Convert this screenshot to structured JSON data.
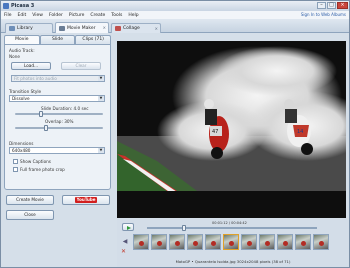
{
  "window": {
    "title": "Picasa 3",
    "minimize": "–",
    "maximize": "□",
    "close": "×"
  },
  "menu": {
    "items": [
      "File",
      "Edit",
      "View",
      "Folder",
      "Picture",
      "Create",
      "Tools",
      "Help"
    ],
    "signin": "Sign In to Web Albums"
  },
  "apptabs": [
    {
      "label": "Library",
      "icon": "library-icon"
    },
    {
      "label": "Movie Maker",
      "icon": "film-icon"
    },
    {
      "label": "Collage",
      "icon": "collage-icon"
    }
  ],
  "subtabs": [
    "Movie",
    "Slide",
    "Clips (71)"
  ],
  "movie": {
    "audio_track_label": "Audio Track:",
    "none_label": "None",
    "load_button": "Load...",
    "clear_button": "Clear",
    "audio_option": "Fit photos into audio",
    "transition_style_label": "Transition Style",
    "transition_style_value": "Dissolve",
    "slide_duration_label": "Slide Duration: 4.0 sec",
    "slide_duration_fraction": 0.3,
    "overlap_label": "Overlap: 30%",
    "overlap_fraction": 0.35,
    "dimensions_label": "Dimensions",
    "dimensions_value": "640x480",
    "show_captions_label": "Show Captions",
    "full_frame_label": "Full frame photo crop"
  },
  "buttons": {
    "create_movie": "Create Movie",
    "youtube": "YouTube",
    "close": "Close"
  },
  "player": {
    "duration_text": "00:01:12 / 00:04:42",
    "position_fraction": 0.22
  },
  "status": "MotoGP • Quarantelo Isolda.jpg    3024x2048 pixels    (38 of 71)",
  "colors": {
    "accent": "#2e5ea8",
    "titlebar": "#c9d5e3",
    "youtube_red": "#d21f1f"
  }
}
